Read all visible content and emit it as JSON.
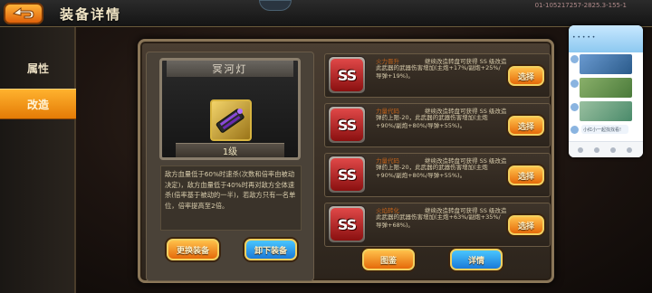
{
  "header": {
    "title": "装备详情",
    "build_code": "01-105217257-2825.3-155-1"
  },
  "nav": {
    "items": [
      {
        "label": "属性",
        "active": false
      },
      {
        "label": "改造",
        "active": true
      }
    ]
  },
  "item": {
    "name": "冥河灯",
    "level": "1级",
    "description": "敌方血量低于60%时速杀(次数和倍率由被动决定)，敌方血量低于40%时再对敌方全体速杀(倍率基于被动的一半)，若敌方只有一名单位，倍率提高至2倍。"
  },
  "actions": {
    "replace": "更换装备",
    "unequip": "卸下装备",
    "illustration": "图鉴",
    "details": "详情"
  },
  "mods": [
    {
      "badge": "SS",
      "title": "火力晋升",
      "hint": "继续改造转盘可获得 SS 级改造",
      "desc": "此武器的武器伤害增加(主炮+17%/副炮+25%/导弹+19%)。",
      "button": "选择"
    },
    {
      "badge": "SS",
      "title": "力量代码",
      "hint": "继续改造转盘可获得 SS 级改造",
      "desc": "弹药上限-20，此武器的武器伤害增加(主炮+90%/副炮+80%/导弹+55%)。",
      "button": "选择"
    },
    {
      "badge": "SS",
      "title": "力量代码",
      "hint": "继续改造转盘可获得 SS 级改造",
      "desc": "弹药上限-20，此武器的武器伤害增加(主炮+90%/副炮+80%/导弹+55%)。",
      "button": "选择"
    },
    {
      "badge": "SS",
      "title": "火焰转化",
      "hint": "继续改造转盘可获得 SS 级改造",
      "desc": "此武器的武器伤害增加(主炮+63%/副炮+35%/导弹+68%)。",
      "button": "选择"
    }
  ],
  "overlay": {
    "chat_caption": "小红小一起找找看!"
  },
  "colors": {
    "accent_orange": "#e56a0a",
    "accent_blue": "#1a7ad8",
    "badge_red": "#c02020",
    "panel": "#3a3128"
  },
  "icons": {
    "back": "back-arrow-icon",
    "weapon": "weapon-launcher-icon"
  }
}
